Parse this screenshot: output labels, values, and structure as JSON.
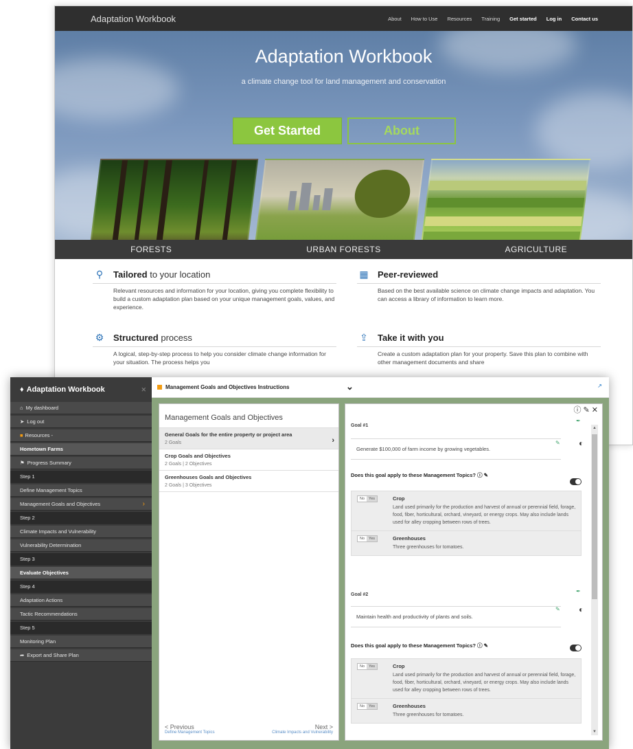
{
  "landing": {
    "brand": "Adaptation Workbook",
    "nav": [
      "About",
      "How to Use",
      "Resources",
      "Training"
    ],
    "nav_bold": [
      "Get started",
      "Log in",
      "Contact us"
    ],
    "hero_title": "Adaptation Workbook",
    "hero_subtitle": "a climate change tool for land management and conservation",
    "btn_start": "Get Started",
    "btn_about": "About",
    "categories": [
      "FORESTS",
      "URBAN FORESTS",
      "AGRICULTURE"
    ],
    "features": [
      {
        "icon": "map-pin-icon",
        "title_bold": "Tailored",
        "title_rest": " to your location",
        "text": "Relevant resources and information for your location, giving you complete flexibility to build a custom adaptation plan based on your unique management goals, values, and experience."
      },
      {
        "icon": "library-icon",
        "title_bold": "Peer-reviewed",
        "title_rest": "",
        "text": "Based on the best available science on climate change impacts and adaptation. You can access a library of information to learn more."
      },
      {
        "icon": "gear-icon",
        "title_bold": "Structured",
        "title_rest": " process",
        "text": "A logical, step-by-step process to help you consider climate change information for your situation. The process helps you"
      },
      {
        "icon": "export-icon",
        "title_bold": "Take it with you",
        "title_rest": "",
        "text": "Create a custom adaptation plan for your property. Save this plan to combine with other management documents and share"
      }
    ]
  },
  "app": {
    "title": "Adaptation Workbook",
    "sidebar": [
      {
        "label": "My dashboard",
        "style": "mid"
      },
      {
        "label": "Log out",
        "style": "mid"
      },
      {
        "label": "Resources -",
        "style": "mid",
        "orange": true
      },
      {
        "label": "Hometown Farms",
        "style": "hl"
      },
      {
        "label": "Progress Summary",
        "style": "mid"
      },
      {
        "label": "Step 1",
        "style": "dark"
      },
      {
        "label": "Define Management Topics",
        "style": "mid"
      },
      {
        "label": "Management Goals and Objectives",
        "style": "mid",
        "arrow": true
      },
      {
        "label": "Step 2",
        "style": "dark"
      },
      {
        "label": "Climate Impacts and Vulnerability",
        "style": "mid"
      },
      {
        "label": "Vulnerability Determination",
        "style": "mid"
      },
      {
        "label": "Step 3",
        "style": "dark"
      },
      {
        "label": "Evaluate Objectives",
        "style": "hl"
      },
      {
        "label": "Step 4",
        "style": "dark"
      },
      {
        "label": "Adaptation Actions",
        "style": "mid"
      },
      {
        "label": "Tactic Recommendations",
        "style": "mid"
      },
      {
        "label": "Step 5",
        "style": "dark"
      },
      {
        "label": "Monitoring Plan",
        "style": "mid"
      },
      {
        "label": "Export and Share Plan",
        "style": "mid"
      }
    ],
    "instructions_label": "Management Goals and Objectives Instructions",
    "left_title": "Management Goals and Objectives",
    "goals_list": [
      {
        "title": "General Goals for the entire property or project area",
        "sub": "2 Goals",
        "selected": true
      },
      {
        "title": "Crop Goals and Objectives",
        "sub": "2 Goals | 2 Objectives",
        "selected": false
      },
      {
        "title": "Greenhouses Goals and Objectives",
        "sub": "2 Goals | 3 Objectives",
        "selected": false
      }
    ],
    "prev_label": "< Previous",
    "prev_sub": "Define Management Topics",
    "next_label": "Next >",
    "next_sub": "Climate Impacts and Vulnerability",
    "goal1_label": "Goal #1",
    "goal1_text": "Generate $100,000 of farm income by growing vegetables.",
    "goal2_label": "Goal #2",
    "goal2_text": "Maintain health and productivity of plants and soils.",
    "apply_q": "Does this goal apply to these Management Topics?",
    "no": "No",
    "yes": "Yes",
    "topic_crop": "Crop",
    "topic_crop_desc": "Land used primarily for the production and harvest of annual or perennial field, forage, food, fiber, horticultural, orchard, vineyard, or energy crops. May also include lands used for alley cropping between rows of trees.",
    "topic_gh": "Greenhouses",
    "topic_gh_desc": "Three greenhouses for tomatoes."
  }
}
